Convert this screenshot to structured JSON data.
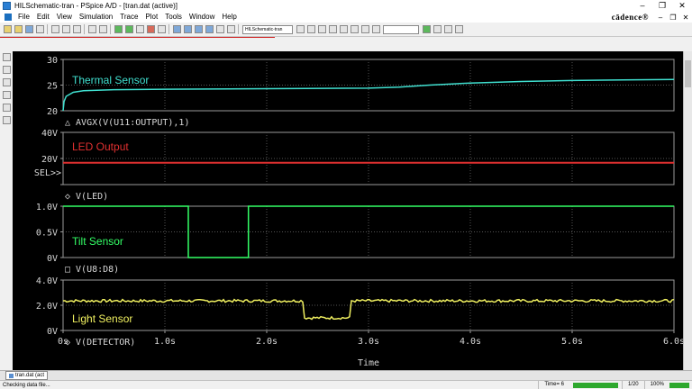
{
  "window": {
    "title": "HILSchematic-tran - PSpice A/D - [tran.dat (active)]",
    "minimize": "–",
    "restore": "❐",
    "close": "✕"
  },
  "menu": {
    "items": [
      "File",
      "Edit",
      "View",
      "Simulation",
      "Trace",
      "Plot",
      "Tools",
      "Window",
      "Help"
    ],
    "logo": "cādence®",
    "doc_min": "–",
    "doc_restore": "❐",
    "doc_close": "✕"
  },
  "toolbar": {
    "profile_combo": "HILSchematic-tran",
    "search_combo": ""
  },
  "plot": {
    "x_axis": {
      "label": "Time",
      "ticks": [
        "0s",
        "1.0s",
        "2.0s",
        "3.0s",
        "4.0s",
        "5.0s",
        "6.0s"
      ],
      "tick_values": [
        0,
        1,
        2,
        3,
        4,
        5,
        6
      ],
      "range": [
        0,
        6
      ]
    },
    "sel_marker": "SEL>>",
    "panels": [
      {
        "name": "Thermal Sensor",
        "trace_label": "△ AVGX(V(U11:OUTPUT),1)",
        "color": "#40e0d0",
        "y_ticks": [
          "30",
          "25",
          "20"
        ],
        "y_range": [
          20,
          30
        ]
      },
      {
        "name": "LED Output",
        "trace_label": "◇ V(LED)",
        "color": "#e03030",
        "y_ticks": [
          "40V",
          "20V",
          ""
        ],
        "y_range": [
          -20,
          40
        ]
      },
      {
        "name": "Tilt Sensor",
        "trace_label": "□ V(U8:D8)",
        "color": "#33ff66",
        "y_ticks": [
          "1.0V",
          "0.5V",
          "0V"
        ],
        "y_range": [
          0,
          1
        ]
      },
      {
        "name": "Light Sensor",
        "trace_label": "◇ V(DETECTOR)",
        "color": "#f0f060",
        "y_ticks": [
          "4.0V",
          "2.0V",
          "0V"
        ],
        "y_range": [
          0,
          4
        ]
      }
    ]
  },
  "chart_data": [
    {
      "type": "line",
      "title": "",
      "series": [
        {
          "name": "Thermal Sensor",
          "x": [
            0,
            0.01,
            0.03,
            0.1,
            0.2,
            0.5,
            1.0,
            2.0,
            3.0,
            3.3,
            3.6,
            4.0,
            4.5,
            5.0,
            5.5,
            6.0
          ],
          "y": [
            20.0,
            21.8,
            22.8,
            23.6,
            23.9,
            24.1,
            24.2,
            24.3,
            24.4,
            24.6,
            25.0,
            25.4,
            25.7,
            25.9,
            26.0,
            26.1
          ]
        }
      ],
      "xlabel": "",
      "ylabel": "",
      "ylim": [
        20,
        30
      ]
    },
    {
      "type": "line",
      "title": "",
      "series": [
        {
          "name": "LED Output",
          "x": [
            0,
            6
          ],
          "y": [
            5.0,
            5.0
          ]
        }
      ],
      "xlabel": "",
      "ylabel": "",
      "ylim": [
        -20,
        40
      ]
    },
    {
      "type": "line",
      "title": "",
      "series": [
        {
          "name": "Tilt Sensor",
          "x": [
            0,
            1.23,
            1.23,
            1.82,
            1.82,
            6.0
          ],
          "y": [
            1.0,
            1.0,
            0.0,
            0.0,
            1.0,
            1.0
          ]
        }
      ],
      "xlabel": "",
      "ylabel": "",
      "ylim": [
        0,
        1
      ]
    },
    {
      "type": "line",
      "title": "",
      "series": [
        {
          "name": "Light Sensor",
          "x": [
            0,
            2.37,
            2.37,
            2.83,
            2.83,
            6.0
          ],
          "y": [
            2.35,
            2.35,
            1.0,
            1.0,
            2.35,
            2.35
          ]
        }
      ],
      "xlabel": "Time",
      "ylabel": "",
      "ylim": [
        0,
        4
      ]
    }
  ],
  "status": {
    "message": "Checking data file...",
    "time_label": "Time= 6",
    "page_info": "1/20",
    "zoom": "100%"
  },
  "doctab": {
    "label": "tran.dat (act"
  }
}
